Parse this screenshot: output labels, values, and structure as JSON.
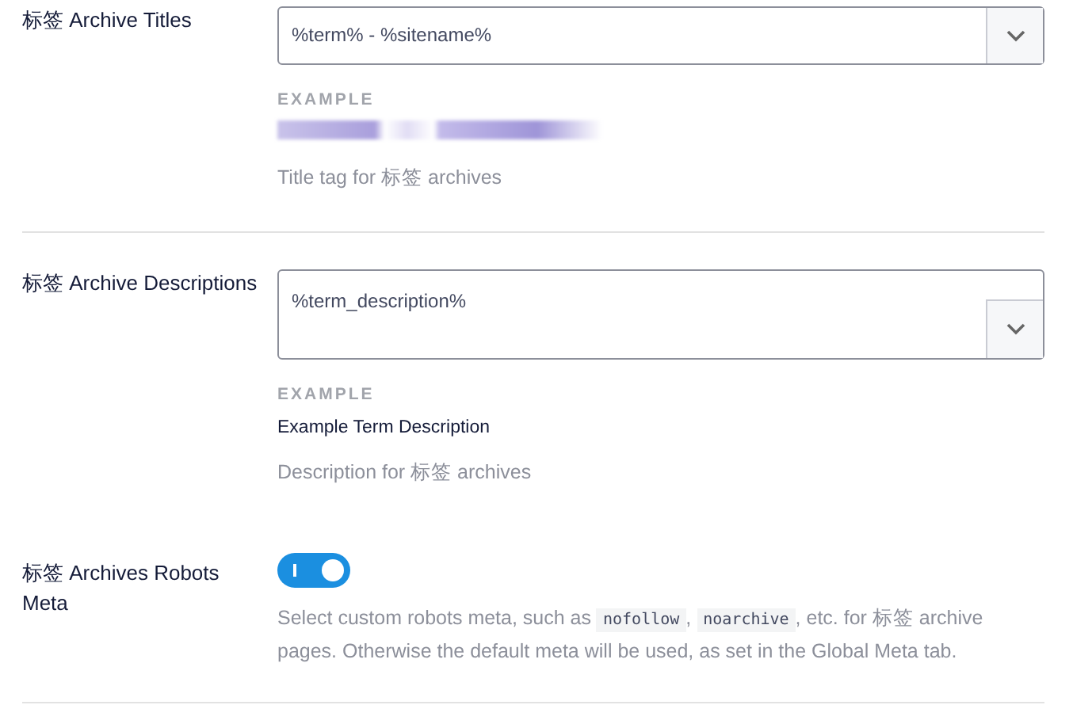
{
  "settings": [
    {
      "kind": "select",
      "label": "标签 Archive Titles",
      "value": "%term% - %sitename%",
      "multiline": false,
      "example": {
        "label": "EXAMPLE",
        "kind": "redacted"
      },
      "help": "Title tag for 标签 archives",
      "divider": true
    },
    {
      "kind": "select",
      "label": "标签 Archive Descriptions",
      "value": "%term_description%",
      "multiline": true,
      "example": {
        "label": "EXAMPLE",
        "kind": "text",
        "value": "Example Term Description"
      },
      "help": "Description for 标签 archives",
      "divider": false
    },
    {
      "kind": "toggle",
      "label": "标签 Archives Robots Meta",
      "on": true,
      "description": [
        {
          "kind": "text",
          "text": "Select custom robots meta, such as "
        },
        {
          "kind": "code",
          "text": "nofollow"
        },
        {
          "kind": "text",
          "text": ", "
        },
        {
          "kind": "code",
          "text": "noarchive"
        },
        {
          "kind": "text",
          "text": ", etc. for 标签 archive pages. Otherwise the default meta will be used, as set in the Global Meta tab."
        }
      ],
      "divider": true
    }
  ]
}
